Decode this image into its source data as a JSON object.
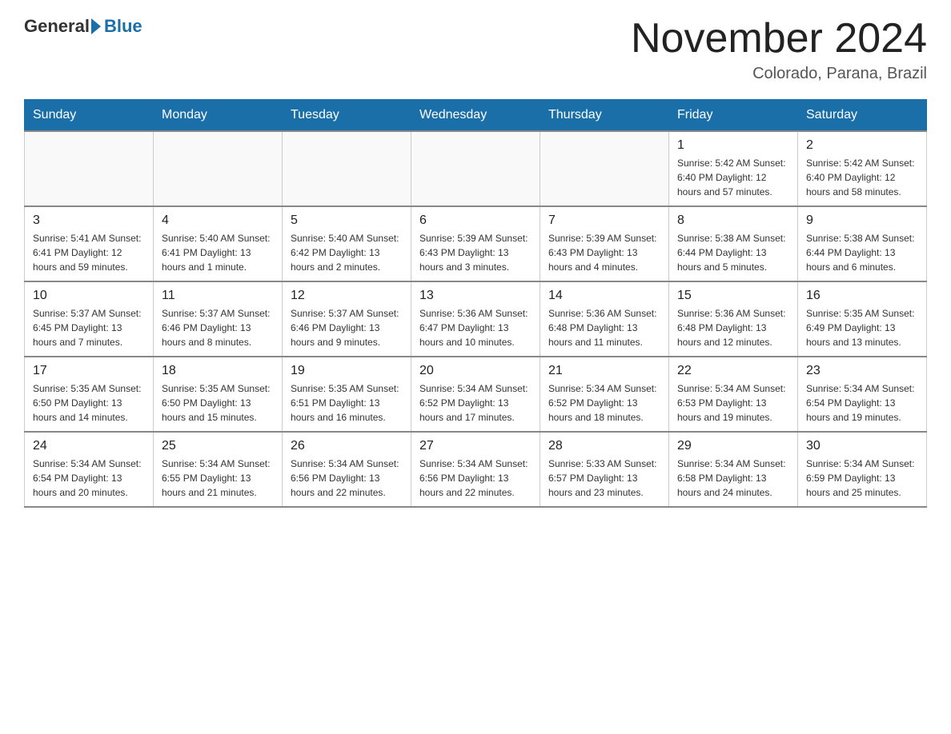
{
  "logo": {
    "general": "General",
    "blue": "Blue"
  },
  "title": "November 2024",
  "subtitle": "Colorado, Parana, Brazil",
  "days_of_week": [
    "Sunday",
    "Monday",
    "Tuesday",
    "Wednesday",
    "Thursday",
    "Friday",
    "Saturday"
  ],
  "weeks": [
    [
      {
        "day": "",
        "info": ""
      },
      {
        "day": "",
        "info": ""
      },
      {
        "day": "",
        "info": ""
      },
      {
        "day": "",
        "info": ""
      },
      {
        "day": "",
        "info": ""
      },
      {
        "day": "1",
        "info": "Sunrise: 5:42 AM\nSunset: 6:40 PM\nDaylight: 12 hours and 57 minutes."
      },
      {
        "day": "2",
        "info": "Sunrise: 5:42 AM\nSunset: 6:40 PM\nDaylight: 12 hours and 58 minutes."
      }
    ],
    [
      {
        "day": "3",
        "info": "Sunrise: 5:41 AM\nSunset: 6:41 PM\nDaylight: 12 hours and 59 minutes."
      },
      {
        "day": "4",
        "info": "Sunrise: 5:40 AM\nSunset: 6:41 PM\nDaylight: 13 hours and 1 minute."
      },
      {
        "day": "5",
        "info": "Sunrise: 5:40 AM\nSunset: 6:42 PM\nDaylight: 13 hours and 2 minutes."
      },
      {
        "day": "6",
        "info": "Sunrise: 5:39 AM\nSunset: 6:43 PM\nDaylight: 13 hours and 3 minutes."
      },
      {
        "day": "7",
        "info": "Sunrise: 5:39 AM\nSunset: 6:43 PM\nDaylight: 13 hours and 4 minutes."
      },
      {
        "day": "8",
        "info": "Sunrise: 5:38 AM\nSunset: 6:44 PM\nDaylight: 13 hours and 5 minutes."
      },
      {
        "day": "9",
        "info": "Sunrise: 5:38 AM\nSunset: 6:44 PM\nDaylight: 13 hours and 6 minutes."
      }
    ],
    [
      {
        "day": "10",
        "info": "Sunrise: 5:37 AM\nSunset: 6:45 PM\nDaylight: 13 hours and 7 minutes."
      },
      {
        "day": "11",
        "info": "Sunrise: 5:37 AM\nSunset: 6:46 PM\nDaylight: 13 hours and 8 minutes."
      },
      {
        "day": "12",
        "info": "Sunrise: 5:37 AM\nSunset: 6:46 PM\nDaylight: 13 hours and 9 minutes."
      },
      {
        "day": "13",
        "info": "Sunrise: 5:36 AM\nSunset: 6:47 PM\nDaylight: 13 hours and 10 minutes."
      },
      {
        "day": "14",
        "info": "Sunrise: 5:36 AM\nSunset: 6:48 PM\nDaylight: 13 hours and 11 minutes."
      },
      {
        "day": "15",
        "info": "Sunrise: 5:36 AM\nSunset: 6:48 PM\nDaylight: 13 hours and 12 minutes."
      },
      {
        "day": "16",
        "info": "Sunrise: 5:35 AM\nSunset: 6:49 PM\nDaylight: 13 hours and 13 minutes."
      }
    ],
    [
      {
        "day": "17",
        "info": "Sunrise: 5:35 AM\nSunset: 6:50 PM\nDaylight: 13 hours and 14 minutes."
      },
      {
        "day": "18",
        "info": "Sunrise: 5:35 AM\nSunset: 6:50 PM\nDaylight: 13 hours and 15 minutes."
      },
      {
        "day": "19",
        "info": "Sunrise: 5:35 AM\nSunset: 6:51 PM\nDaylight: 13 hours and 16 minutes."
      },
      {
        "day": "20",
        "info": "Sunrise: 5:34 AM\nSunset: 6:52 PM\nDaylight: 13 hours and 17 minutes."
      },
      {
        "day": "21",
        "info": "Sunrise: 5:34 AM\nSunset: 6:52 PM\nDaylight: 13 hours and 18 minutes."
      },
      {
        "day": "22",
        "info": "Sunrise: 5:34 AM\nSunset: 6:53 PM\nDaylight: 13 hours and 19 minutes."
      },
      {
        "day": "23",
        "info": "Sunrise: 5:34 AM\nSunset: 6:54 PM\nDaylight: 13 hours and 19 minutes."
      }
    ],
    [
      {
        "day": "24",
        "info": "Sunrise: 5:34 AM\nSunset: 6:54 PM\nDaylight: 13 hours and 20 minutes."
      },
      {
        "day": "25",
        "info": "Sunrise: 5:34 AM\nSunset: 6:55 PM\nDaylight: 13 hours and 21 minutes."
      },
      {
        "day": "26",
        "info": "Sunrise: 5:34 AM\nSunset: 6:56 PM\nDaylight: 13 hours and 22 minutes."
      },
      {
        "day": "27",
        "info": "Sunrise: 5:34 AM\nSunset: 6:56 PM\nDaylight: 13 hours and 22 minutes."
      },
      {
        "day": "28",
        "info": "Sunrise: 5:33 AM\nSunset: 6:57 PM\nDaylight: 13 hours and 23 minutes."
      },
      {
        "day": "29",
        "info": "Sunrise: 5:34 AM\nSunset: 6:58 PM\nDaylight: 13 hours and 24 minutes."
      },
      {
        "day": "30",
        "info": "Sunrise: 5:34 AM\nSunset: 6:59 PM\nDaylight: 13 hours and 25 minutes."
      }
    ]
  ]
}
